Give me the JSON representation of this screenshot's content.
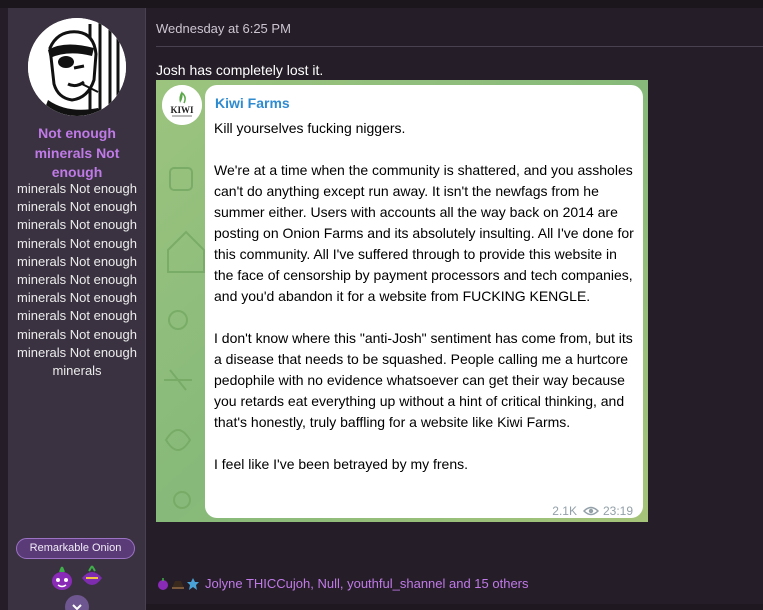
{
  "user": {
    "title": "Not enough minerals Not enough",
    "subtitle": "minerals Not enough minerals Not enough minerals Not enough minerals Not enough minerals Not enough minerals Not enough minerals Not enough minerals Not enough minerals Not enough minerals Not enough minerals",
    "badge": "Remarkable Onion"
  },
  "post": {
    "date": "Wednesday at 6:25 PM",
    "text": "Josh has completely lost it."
  },
  "embed": {
    "channel": "Kiwi Farms",
    "avatar_text": "KIWI",
    "paragraphs": [
      "Kill yourselves fucking niggers.",
      "We're at a time when the community is shattered, and you assholes can't do anything except run away. It isn't the newfags from he summer either. Users with accounts all the way back on 2014 are posting on Onion Farms and its absolutely insulting. All I've done for this community. All I've suffered through to provide this website in the face of censorship by payment processors and tech companies, and you'd abandon it for a website from FUCKING KENGLE.",
      "I don't know where this \"anti-Josh\" sentiment has come from, but its a disease that needs to be squashed. People calling me a hurtcore pedophile with no evidence whatsoever can get their way because you retards eat everything up without a hint of critical thinking, and that's honestly, truly baffling for a website like Kiwi Farms.",
      "I feel like I've been betrayed by my frens."
    ],
    "views": "2.1K",
    "time": "23:19"
  },
  "reactions": {
    "text": "Jolyne THICCujoh, Null, youthful_shannel and 15 others"
  },
  "colors": {
    "accent": "#c07ae8",
    "link": "#2f8bd0",
    "embed_bg": "#8cbd73"
  }
}
